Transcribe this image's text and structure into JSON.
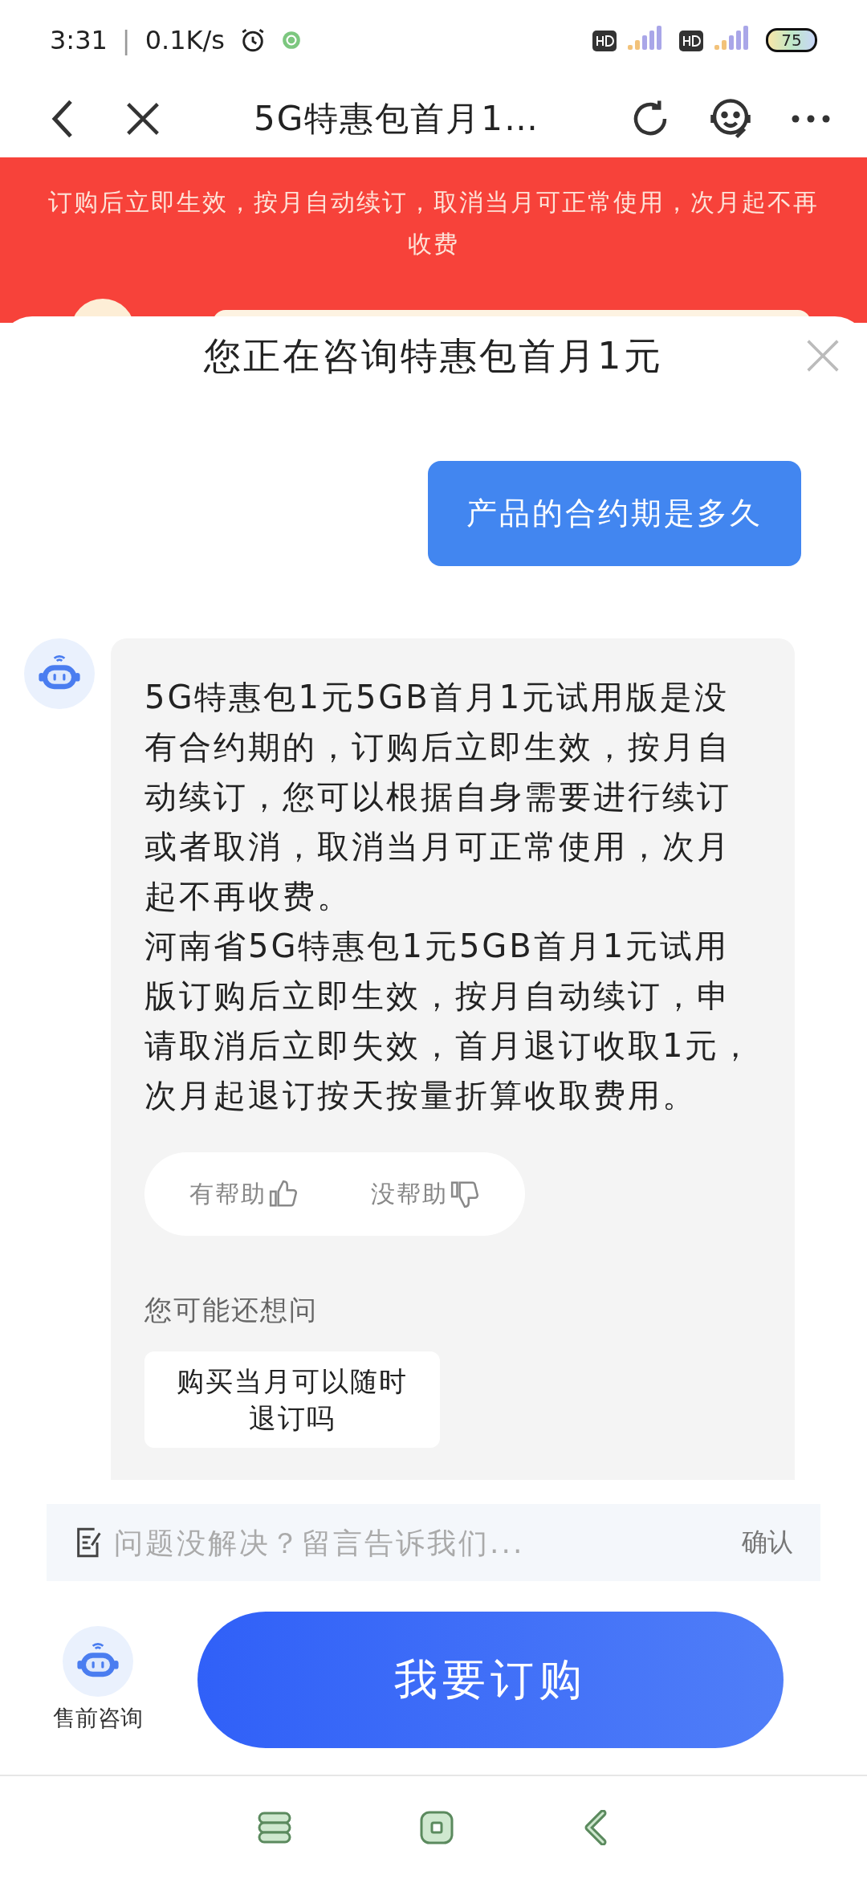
{
  "status_bar": {
    "time": "3:31",
    "separator": "|",
    "speed": "0.1K/s",
    "battery": "75"
  },
  "header": {
    "title": "5G特惠包首月1…"
  },
  "banner": {
    "text": "订购后立即生效，按月自动续订，取消当月可正常使用，次月起不再收费"
  },
  "sheet": {
    "title": "您正在咨询特惠包首月1元"
  },
  "messages": [
    {
      "kind": "user",
      "text": "产品的合约期是多久"
    },
    {
      "kind": "bot",
      "paragraphs": [
        "5G特惠包1元5GB首月1元试用版是没有合约期的，订购后立即生效，按月自动续订，您可以根据自身需要进行续订或者取消，取消当月可正常使用，次月起不再收费。",
        "河南省5G特惠包1元5GB首月1元试用版订购后立即生效，按月自动续订，申请取消后立即失效，首月退订收取1元，次月起退订按天按量折算收取费用。"
      ],
      "feedback": [
        {
          "kind": "up",
          "label": "有帮助"
        },
        {
          "kind": "down",
          "label": "没帮助"
        }
      ],
      "suggestions_title": "您可能还想问",
      "suggestions": [
        "购买当月可以随时退订吗"
      ]
    }
  ],
  "input": {
    "placeholder": "问题没解决？留言告诉我们...",
    "confirm": "确认"
  },
  "footer": {
    "consult_label": "售前咨询",
    "order_button": "我要订购"
  }
}
